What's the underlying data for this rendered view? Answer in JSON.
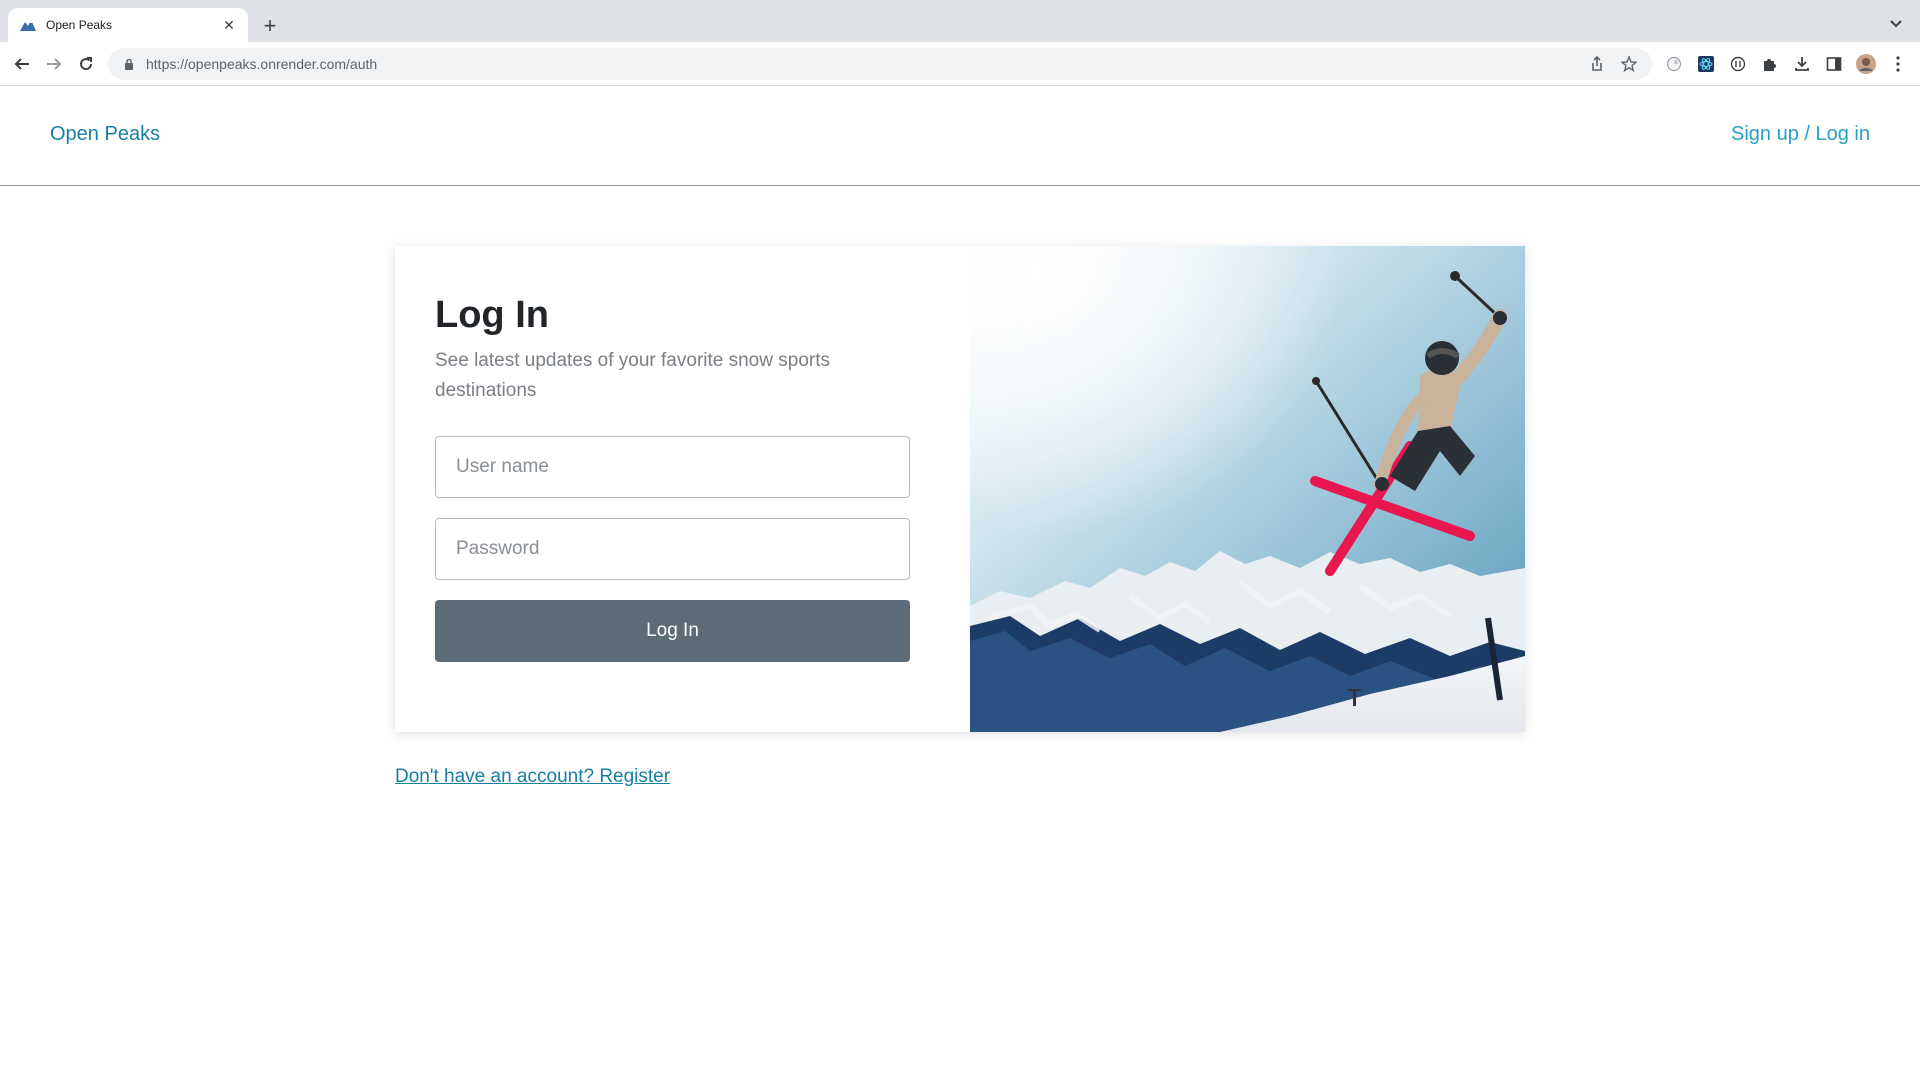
{
  "browser": {
    "tab_title": "Open Peaks",
    "url_host": "https://openpeaks.onrender.com",
    "url_path": "/auth"
  },
  "header": {
    "brand": "Open Peaks",
    "auth_link": "Sign up / Log in"
  },
  "login": {
    "title": "Log In",
    "subtitle": "See latest updates of your favorite snow sports destinations",
    "username_placeholder": "User name",
    "password_placeholder": "Password",
    "submit_label": "Log In",
    "register_link": "Don't have an account? Register"
  },
  "colors": {
    "brand": "#177fa3",
    "button": "#5b6b77",
    "ski": "#e8174f"
  }
}
